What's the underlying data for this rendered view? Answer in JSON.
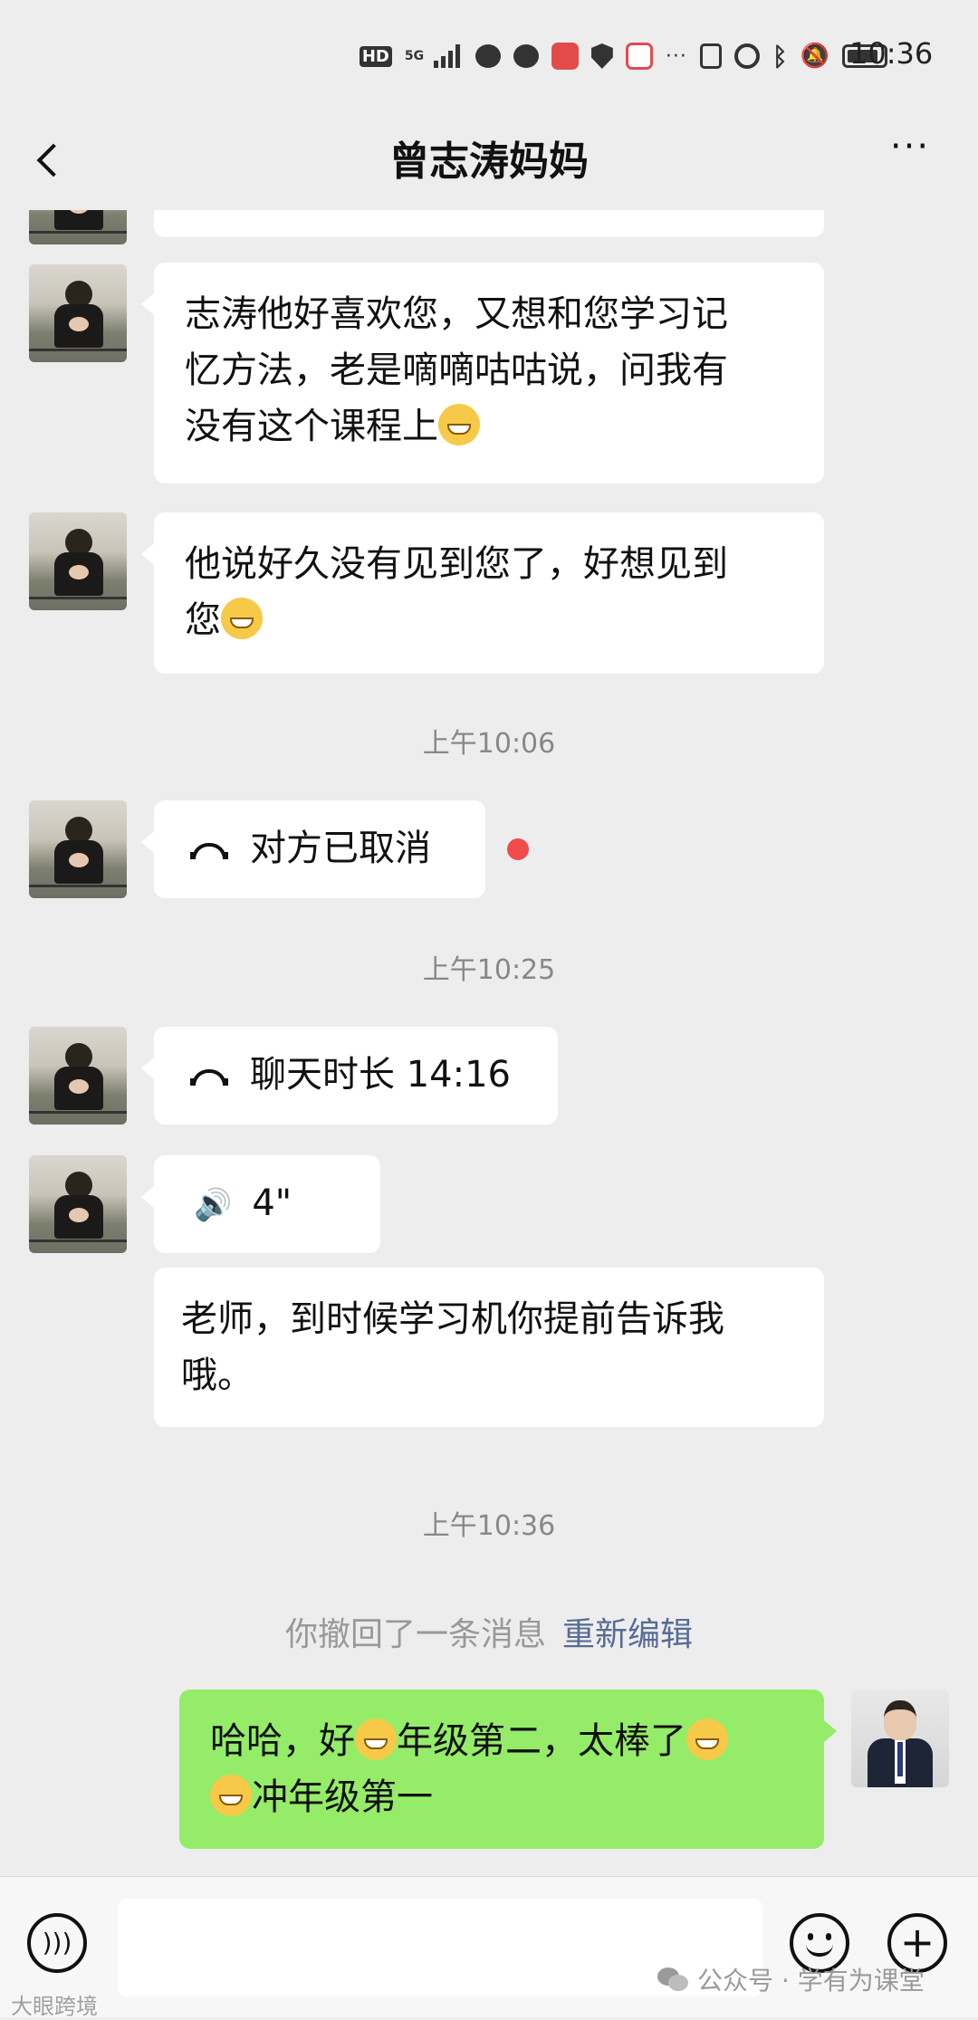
{
  "status_bar": {
    "network": "HD",
    "net_type": "5G",
    "time": "10:36"
  },
  "header": {
    "title": "曾志涛妈妈",
    "more": "···"
  },
  "messages": {
    "m1_line1": "志涛他好喜欢您，又想和您学习记",
    "m1_line2": "忆方法，老是嘀嘀咕咕说，问我有",
    "m1_line3": "没有这个课程上",
    "m2_line1": "他说好久没有见到您了，好想见到",
    "m2_line2": "您",
    "ts1": "上午10:06",
    "call1": "对方已取消",
    "ts2": "上午10:25",
    "call2": "聊天时长 14:16",
    "voice_duration": "4\"",
    "m3_line1": "老师，到时候学习机你提前告诉我",
    "m3_line2": "哦。",
    "ts3": "上午10:36",
    "recall_notice": "你撤回了一条消息",
    "re_edit": "重新编辑",
    "my_line1_a": "哈哈，好",
    "my_line1_b": "年级第二，太棒了",
    "my_line2": "冲年级第一"
  },
  "watermark": {
    "right": "公众号 · 学有为课堂",
    "left": "大眼跨境"
  }
}
